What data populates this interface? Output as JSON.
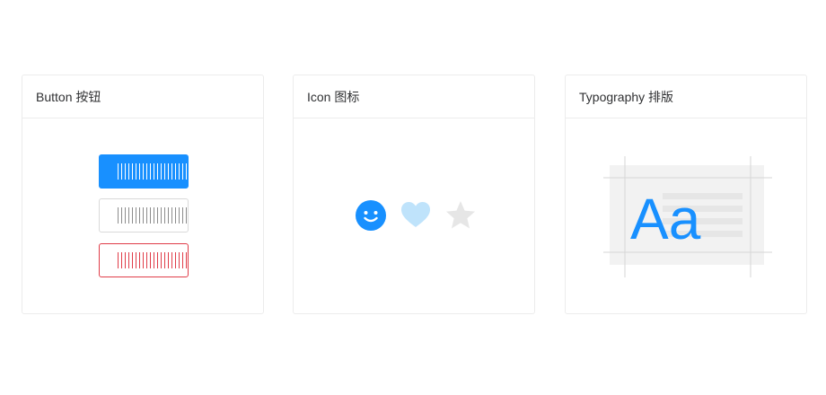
{
  "cards": [
    {
      "title": "Button 按钮",
      "preview": "button-variants"
    },
    {
      "title": "Icon 图标",
      "preview": "icons",
      "icons": [
        "smile-icon",
        "heart-icon",
        "star-icon"
      ]
    },
    {
      "title": "Typography 排版",
      "preview": "typography",
      "sample_text": "Aa"
    }
  ],
  "colors": {
    "primary": "#1890ff",
    "danger": "#e03c48",
    "border": "#ececec",
    "muted": "#e8e8e8",
    "heart": "#bfe3fb"
  }
}
